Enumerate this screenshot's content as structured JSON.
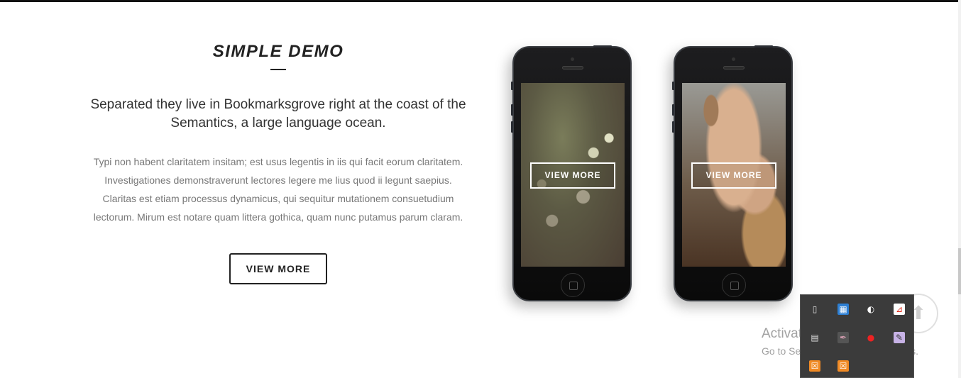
{
  "section": {
    "title": "SIMPLE DEMO",
    "lead": "Separated they live in Bookmarksgrove right at the coast of the Semantics, a large language ocean.",
    "body": "Typi non habent claritatem insitam; est usus legentis in iis qui facit eorum claritatem. Investigationes demonstraverunt lectores legere me lius quod ii legunt saepius. Claritas est etiam processus dynamicus, qui sequitur mutationem consuetudium lectorum. Mirum est notare quam littera gothica, quam nunc putamus parum claram.",
    "button_label": "VIEW MORE"
  },
  "phones": [
    {
      "button_label": "VIEW MORE",
      "image": "flowers-photo"
    },
    {
      "button_label": "VIEW MORE",
      "image": "hands-carving-wood-photo"
    }
  ],
  "scroll_top": {
    "icon": "arrow-up-icon"
  },
  "watermark": {
    "title": "Activate Windows",
    "subtitle": "Go to Settings to activate Windows."
  },
  "tray_icons": [
    "usb-icon",
    "network-app-icon",
    "spy-icon",
    "pdf-icon",
    "grid-icon",
    "feather-icon",
    "red-circle-icon",
    "notes-icon",
    "xampp-icon",
    "xampp-icon-2"
  ]
}
